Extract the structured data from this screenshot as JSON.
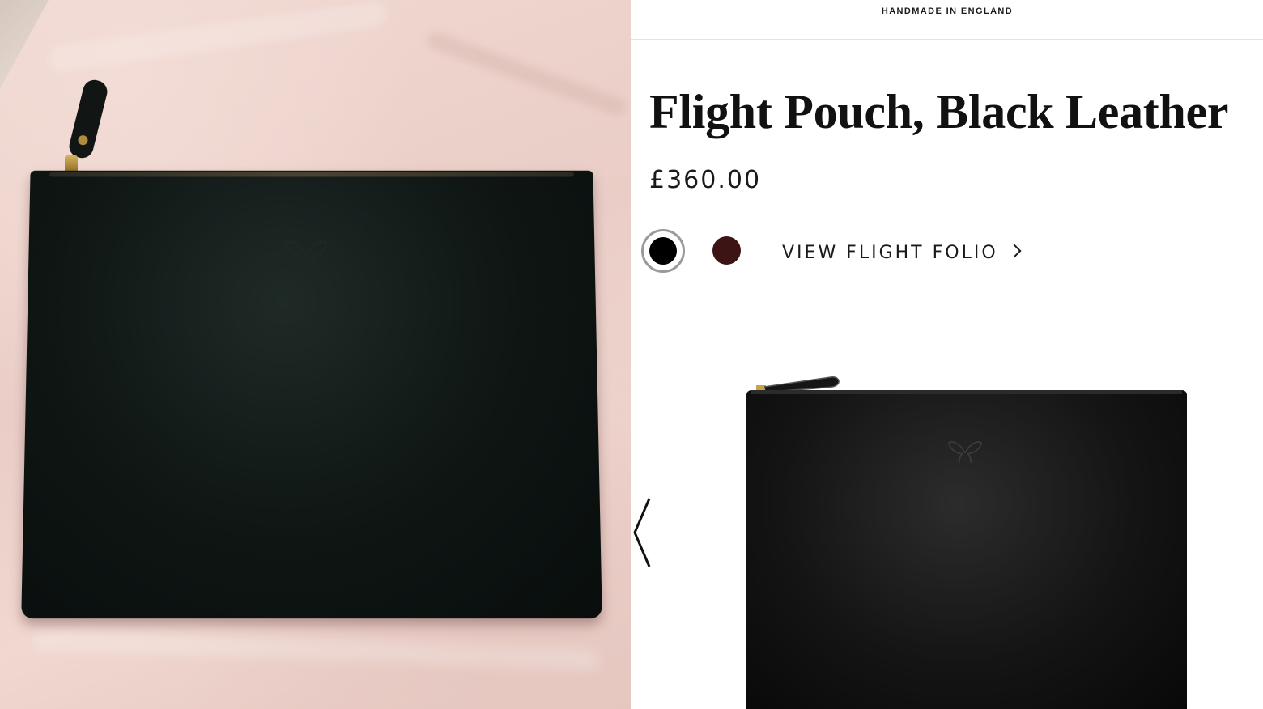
{
  "banner": {
    "text": "HANDMADE IN ENGLAND"
  },
  "product": {
    "title": "Flight Pouch, Black Leather",
    "price": "£360.00",
    "swatches": [
      {
        "name": "black",
        "color": "#000000",
        "selected": true
      },
      {
        "name": "brown",
        "color": "#3d1414",
        "selected": false
      }
    ],
    "view_link": "VIEW FLIGHT FOLIO"
  },
  "icons": {
    "view_link_arrow": "chevron-right-icon",
    "gallery_prev": "chevron-left-icon",
    "emboss_logo": "butterfly-icon"
  }
}
